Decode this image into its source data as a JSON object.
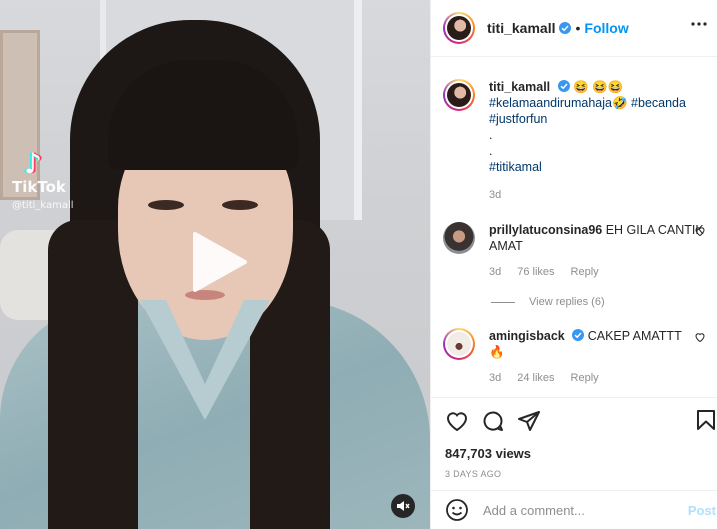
{
  "video": {
    "watermark_brand": "TikTok",
    "watermark_user": "@titi_kamall",
    "play_icon": "play-icon",
    "sound_icon": "speaker-mute-icon"
  },
  "header": {
    "username": "titi_kamall",
    "separator": "•",
    "follow_label": "Follow",
    "more_icon": "ellipsis-icon"
  },
  "caption": {
    "username": "titi_kamall",
    "emojis": "😆 😆😆",
    "tag1": "#kelamaandirumahaja🤣",
    "tag2": "#becanda",
    "tag3": "#justforfun",
    "dot1": ".",
    "dot2": ".",
    "tag4": "#titikamal",
    "time": "3d"
  },
  "comments": [
    {
      "username": "prillylatuconsina96",
      "text": "EH GILA CANTIK AMAT",
      "time": "3d",
      "likes": "76 likes",
      "reply": "Reply",
      "view_replies": "View replies (6)"
    },
    {
      "username": "amingisback",
      "text": "CAKEP AMATTT",
      "emoji": "🔥",
      "time": "3d",
      "likes": "24 likes",
      "reply": "Reply"
    }
  ],
  "actions": {
    "views": "847,703 views",
    "ago": "3 DAYS AGO"
  },
  "add_comment": {
    "placeholder": "Add a comment...",
    "post_label": "Post"
  },
  "colors": {
    "accent": "#0095f6",
    "verified": "#3897f0",
    "post_disabled": "#b2dffc"
  }
}
